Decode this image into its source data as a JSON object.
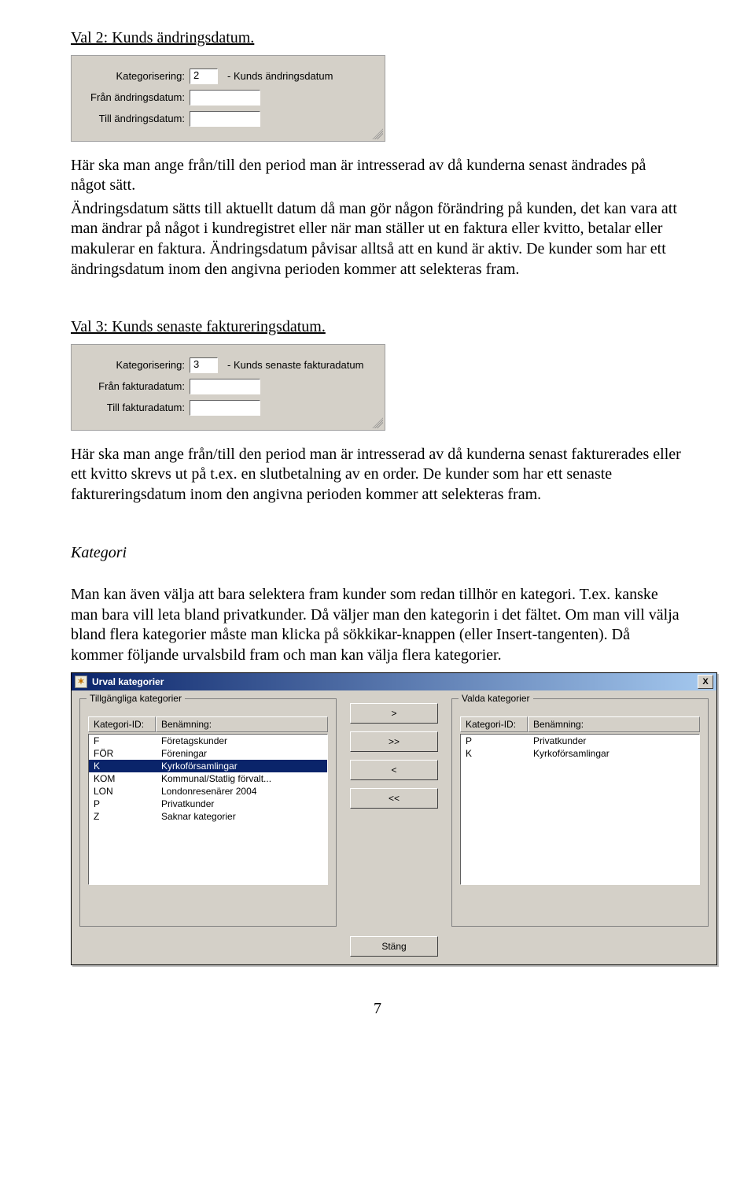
{
  "headings": {
    "val2": "Val 2: Kunds ändringsdatum.",
    "val3": "Val 3: Kunds senaste faktureringsdatum.",
    "kategori": "Kategori"
  },
  "paragraphs": {
    "p1": "Här ska man ange från/till den period man är intresserad av då kunderna senast ändrades på något sätt.",
    "p2": "Ändringsdatum sätts till aktuellt datum då man gör någon förändring på kunden, det kan vara att man ändrar på något i kundregistret eller när man ställer ut en faktura eller kvitto, betalar eller makulerar en faktura. Ändringsdatum påvisar alltså att en kund är aktiv. De kunder som har ett ändringsdatum inom den angivna perioden kommer att selekteras fram.",
    "p3": "Här ska man ange från/till den period man är intresserad av då kunderna senast fakturerades eller ett kvitto skrevs ut på t.ex. en slutbetalning av en order. De kunder som har ett senaste faktureringsdatum inom den angivna perioden kommer att selekteras fram.",
    "p4": "Man kan även välja att bara selektera fram kunder som redan tillhör en kategori. T.ex. kanske man bara vill leta bland privatkunder. Då väljer man den kategorin i det fältet. Om man vill välja bland flera kategorier måste man klicka på sökkikar-knappen (eller Insert-tangenten). Då kommer följande urvalsbild fram och man kan välja flera kategorier."
  },
  "panel1": {
    "label_kat": "Kategorisering:",
    "val_kat": "2",
    "desc": "- Kunds ändringsdatum",
    "label_from": "Från ändringsdatum:",
    "label_to": "Till ändringsdatum:",
    "val_from": "",
    "val_to": ""
  },
  "panel2": {
    "label_kat": "Kategorisering:",
    "val_kat": "3",
    "desc": "- Kunds senaste fakturadatum",
    "label_from": "Från fakturadatum:",
    "label_to": "Till fakturadatum:",
    "val_from": "",
    "val_to": ""
  },
  "dialog": {
    "title": "Urval kategorier",
    "group_left": "Tillgängliga kategorier",
    "group_right": "Valda kategorier",
    "col_id": "Kategori-ID:",
    "col_name": "Benämning:",
    "btn_add": ">",
    "btn_add_all": ">>",
    "btn_remove": "<",
    "btn_remove_all": "<<",
    "btn_close": "Stäng",
    "close_x": "X",
    "left": [
      {
        "id": "F",
        "name": "Företagskunder",
        "selected": false
      },
      {
        "id": "FÖR",
        "name": "Föreningar",
        "selected": false
      },
      {
        "id": "K",
        "name": "Kyrkoförsamlingar",
        "selected": true
      },
      {
        "id": "KOM",
        "name": "Kommunal/Statlig förvalt...",
        "selected": false
      },
      {
        "id": "LON",
        "name": "Londonresenärer 2004",
        "selected": false
      },
      {
        "id": "P",
        "name": "Privatkunder",
        "selected": false
      },
      {
        "id": "Z",
        "name": "Saknar kategorier",
        "selected": false
      }
    ],
    "right": [
      {
        "id": "P",
        "name": "Privatkunder"
      },
      {
        "id": "K",
        "name": "Kyrkoförsamlingar"
      }
    ]
  },
  "page_number": "7"
}
